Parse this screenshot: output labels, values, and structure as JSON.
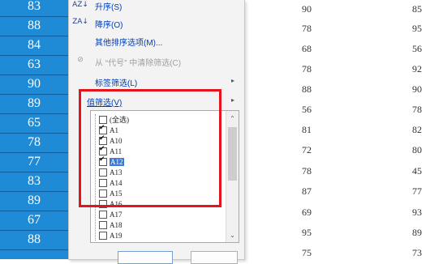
{
  "left_values": [
    "83",
    "88",
    "84",
    "63",
    "90",
    "89",
    "65",
    "78",
    "77",
    "83",
    "89",
    "67",
    "88"
  ],
  "right_values": [
    [
      "90",
      "85"
    ],
    [
      "78",
      "95"
    ],
    [
      "68",
      "56"
    ],
    [
      "78",
      "92"
    ],
    [
      "88",
      "90"
    ],
    [
      "56",
      "78"
    ],
    [
      "81",
      "82"
    ],
    [
      "72",
      "80"
    ],
    [
      "78",
      "45"
    ],
    [
      "87",
      "77"
    ],
    [
      "69",
      "93"
    ],
    [
      "95",
      "89"
    ],
    [
      "75",
      "73"
    ]
  ],
  "menu": {
    "sort_asc": "升序(S)",
    "sort_desc": "降序(O)",
    "more_sort": "其他排序选项(M)...",
    "clear_filter": "从 “代号” 中清除筛选(C)",
    "label_filter": "标签筛选(L)",
    "value_filter": "值筛选(V)",
    "sort_asc_icon": "AZ",
    "sort_desc_icon": "ZA"
  },
  "list": [
    {
      "label": "(全选)",
      "checked": false
    },
    {
      "label": "A1",
      "checked": true
    },
    {
      "label": "A10",
      "checked": true
    },
    {
      "label": "A11",
      "checked": true
    },
    {
      "label": "A12",
      "checked": true,
      "selected": true
    },
    {
      "label": "A13",
      "checked": false
    },
    {
      "label": "A14",
      "checked": false
    },
    {
      "label": "A15",
      "checked": false
    },
    {
      "label": "A16",
      "checked": false
    },
    {
      "label": "A17",
      "checked": false
    },
    {
      "label": "A18",
      "checked": false
    },
    {
      "label": "A19",
      "checked": false
    }
  ],
  "colors": {
    "accent": "#1f8bd6",
    "highlight_box": "#e4131c"
  }
}
